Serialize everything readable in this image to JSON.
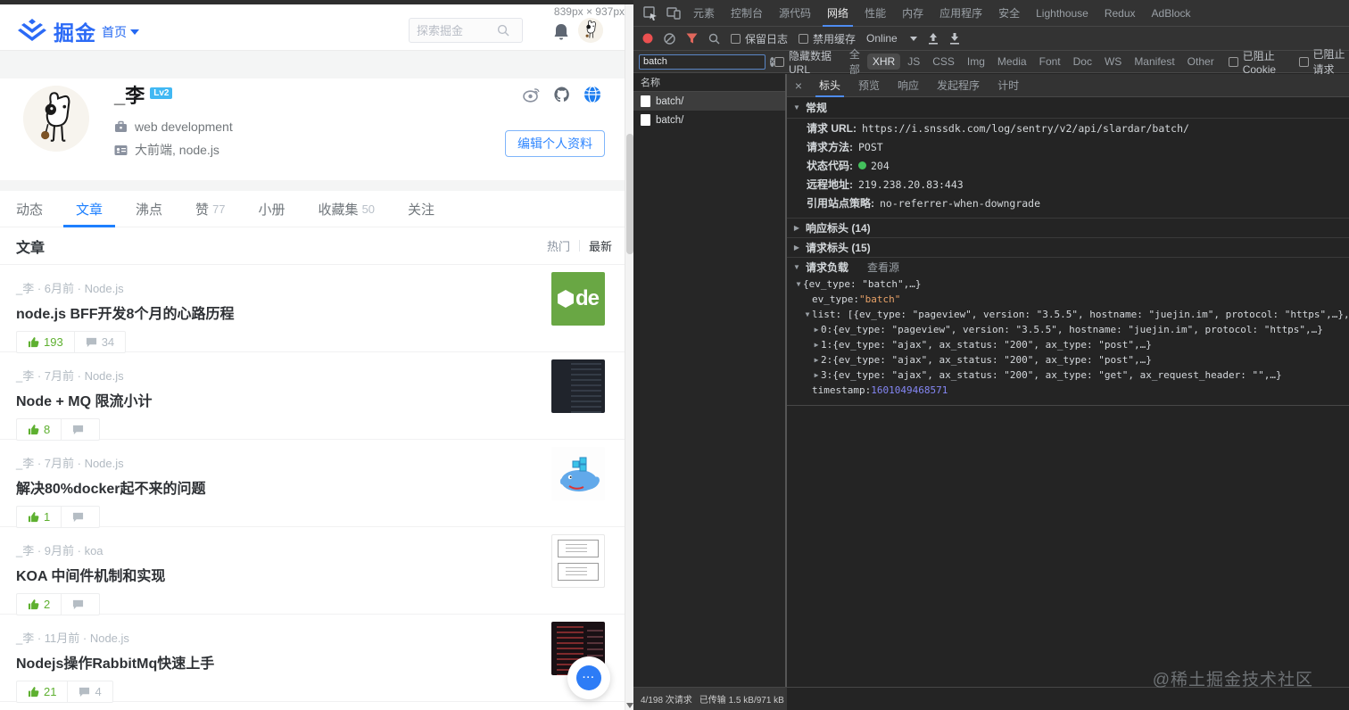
{
  "juejin": {
    "header": {
      "logo_text": "掘金",
      "nav_home": "首页",
      "search_placeholder": "探索掘金",
      "viewport_dims": "839px × 937px"
    },
    "profile": {
      "name": "_李",
      "level": "Lv2",
      "job": "web development",
      "intro": "大前端, node.js",
      "edit_button": "编辑个人资料"
    },
    "tabs": [
      {
        "label": "动态",
        "count": ""
      },
      {
        "label": "文章",
        "count": ""
      },
      {
        "label": "沸点",
        "count": ""
      },
      {
        "label": "赞",
        "count": "77"
      },
      {
        "label": "小册",
        "count": ""
      },
      {
        "label": "收藏集",
        "count": "50"
      },
      {
        "label": "关注",
        "count": ""
      }
    ],
    "list_header": {
      "title": "文章",
      "sort_hot": "热门",
      "sort_new": "最新"
    },
    "articles": [
      {
        "meta": "_李 · 6月前 · Node.js",
        "title": "node.js BFF开发8个月的心路历程",
        "likes": "193",
        "comments": "34"
      },
      {
        "meta": "_李 · 7月前 · Node.js",
        "title": "Node + MQ 限流小计",
        "likes": "8",
        "comments": ""
      },
      {
        "meta": "_李 · 7月前 · Node.js",
        "title": "解决80%docker起不来的问题",
        "likes": "1",
        "comments": ""
      },
      {
        "meta": "_李 · 9月前 · koa",
        "title": "KOA 中间件机制和实现",
        "likes": "2",
        "comments": ""
      },
      {
        "meta": "_李 · 11月前 · Node.js",
        "title": "Nodejs操作RabbitMq快速上手",
        "likes": "21",
        "comments": "4"
      }
    ]
  },
  "devtools": {
    "tabs": [
      "元素",
      "控制台",
      "源代码",
      "网络",
      "性能",
      "内存",
      "应用程序",
      "安全",
      "Lighthouse",
      "Redux",
      "AdBlock"
    ],
    "toolbar": {
      "preserve_log": "保留日志",
      "disable_cache": "禁用缓存",
      "throttling": "Online"
    },
    "filter": {
      "value": "batch",
      "hide_data_urls": "隐藏数据 URL",
      "types": [
        "全部",
        "XHR",
        "JS",
        "CSS",
        "Img",
        "Media",
        "Font",
        "Doc",
        "WS",
        "Manifest",
        "Other"
      ],
      "blocked_cookies": "已阻止 Cookie",
      "blocked_requests": "已阻止请求"
    },
    "requests": {
      "name_header": "名称",
      "rows": [
        "batch/",
        "batch/"
      ]
    },
    "detail": {
      "tabs": [
        "标头",
        "预览",
        "响应",
        "发起程序",
        "计时"
      ],
      "general_title": "常规",
      "general": [
        {
          "k": "请求 URL:",
          "v": "https://i.snssdk.com/log/sentry/v2/api/slardar/batch/"
        },
        {
          "k": "请求方法:",
          "v": "POST"
        },
        {
          "k": "状态代码:",
          "v": "204"
        },
        {
          "k": "远程地址:",
          "v": "219.238.20.83:443"
        },
        {
          "k": "引用站点策略:",
          "v": "no-referrer-when-downgrade"
        }
      ],
      "response_headers": "响应标头 (14)",
      "request_headers": "请求标头 (15)",
      "payload_title": "请求负载",
      "view_source": "查看源",
      "payload": {
        "root_preview": "{ev_type: \"batch\",…}",
        "ev_key": "ev_type: ",
        "ev_value": "\"batch\"",
        "list_line": "list: [{ev_type: \"pageview\", version: \"3.5.5\", hostname: \"juejin.im\", protocol: \"https\",…},…]",
        "items": [
          {
            "idx": "0: ",
            "preview": "{ev_type: \"pageview\", version: \"3.5.5\", hostname: \"juejin.im\", protocol: \"https\",…}"
          },
          {
            "idx": "1: ",
            "preview": "{ev_type: \"ajax\", ax_status: \"200\", ax_type: \"post\",…}"
          },
          {
            "idx": "2: ",
            "preview": "{ev_type: \"ajax\", ax_status: \"200\", ax_type: \"post\",…}"
          },
          {
            "idx": "3: ",
            "preview": "{ev_type: \"ajax\", ax_status: \"200\", ax_type: \"get\", ax_request_header: \"\",…}"
          }
        ],
        "timestamp_key": "timestamp: ",
        "timestamp_value": "1601049468571"
      }
    },
    "status_bar": {
      "requests": "4/198 次请求",
      "transferred": "已传输 1.5 kB/971 kB"
    }
  },
  "watermark": "@稀土掘金技术社区"
}
